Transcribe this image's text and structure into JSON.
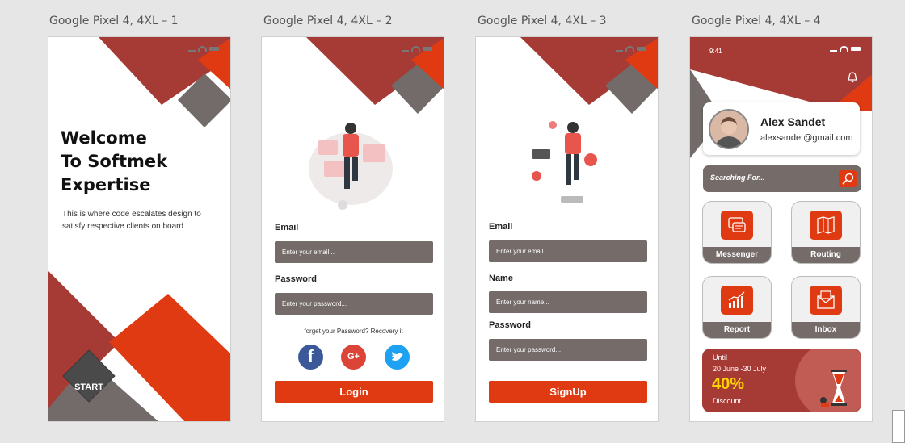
{
  "frames": [
    {
      "title": "Google Pixel 4, 4XL – 1"
    },
    {
      "title": "Google Pixel 4, 4XL – 2"
    },
    {
      "title": "Google Pixel 4, 4XL – 3"
    },
    {
      "title": "Google Pixel 4, 4XL – 4"
    }
  ],
  "welcome": {
    "heading_line1": "Welcome",
    "heading_line2": "To Softmek",
    "heading_line3": "Expertise",
    "subtitle": "This is where code escalates design to satisfy respective clients on board",
    "start_label": "START"
  },
  "login": {
    "email_label": "Email",
    "email_placeholder": "Enter your email...",
    "password_label": "Password",
    "password_placeholder": "Enter your password...",
    "forgot_text": "forget your Password? Recovery it",
    "login_button": "Login",
    "social": [
      "facebook",
      "google-plus",
      "twitter"
    ]
  },
  "signup": {
    "email_label": "Email",
    "email_placeholder": "Enter your email...",
    "name_label": "Name",
    "name_placeholder": "Enter your name...",
    "password_label": "Password",
    "password_placeholder": "Enter your password...",
    "signup_button": "SignUp"
  },
  "dashboard": {
    "time": "9:41",
    "user_name": "Alex Sandet",
    "user_email": "alexsandet@gmail.com",
    "search_placeholder": "Searching For...",
    "tiles": [
      {
        "label": "Messenger",
        "icon": "chat-icon"
      },
      {
        "label": "Routing",
        "icon": "map-icon"
      },
      {
        "label": "Report",
        "icon": "chart-icon"
      },
      {
        "label": "Inbox",
        "icon": "mail-icon"
      }
    ],
    "promo": {
      "until": "Until",
      "dates": "20 June -30 July",
      "percent": "40%",
      "discount": "Discount"
    }
  },
  "colors": {
    "accent": "#e03a12",
    "dark_red": "#a63a35",
    "gray": "#756c6a",
    "background": "#e6e6e6"
  }
}
